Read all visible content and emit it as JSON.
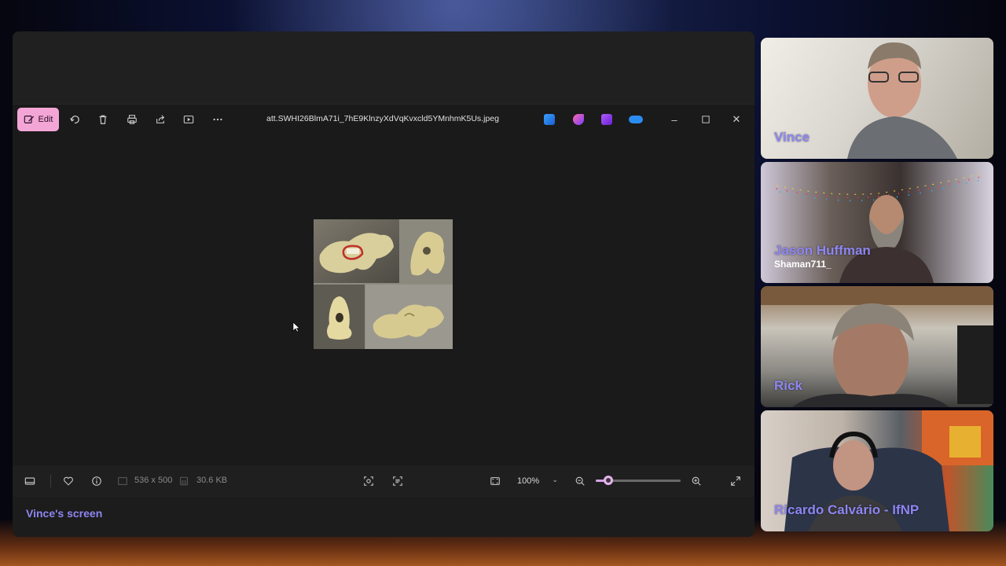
{
  "viewer": {
    "edit_label": "Edit",
    "filename": "att.SWHI26BlmA71i_7hE9KlnzyXdVqKvxcld5YMnhmK5Us.jpeg",
    "dimensions": "536 x 500",
    "file_size": "30.6 KB",
    "zoom_level": "100%",
    "zoom_slider_fraction": 0.15
  },
  "share_label": "Vince's screen",
  "participants": [
    {
      "name": "Vince",
      "subtitle": ""
    },
    {
      "name": "Jason Huffman",
      "subtitle": "Shaman711_"
    },
    {
      "name": "Rick",
      "subtitle": ""
    },
    {
      "name": "Ricardo Calvário - IfNP",
      "subtitle": ""
    }
  ],
  "colors": {
    "accent_name": "#8e86f2",
    "edit_button": "#f3a6d6",
    "slider_accent": "#e8b2f0"
  },
  "icons": [
    "edit-icon",
    "rotate-icon",
    "delete-icon",
    "print-icon",
    "share-icon",
    "slideshow-icon",
    "more-icon",
    "film-strip-icon",
    "heart-icon",
    "info-icon",
    "image-size-icon",
    "file-size-icon",
    "visual-search-icon",
    "text-scan-icon",
    "fit-icon",
    "zoom-out-icon",
    "zoom-in-icon",
    "fullscreen-icon"
  ]
}
